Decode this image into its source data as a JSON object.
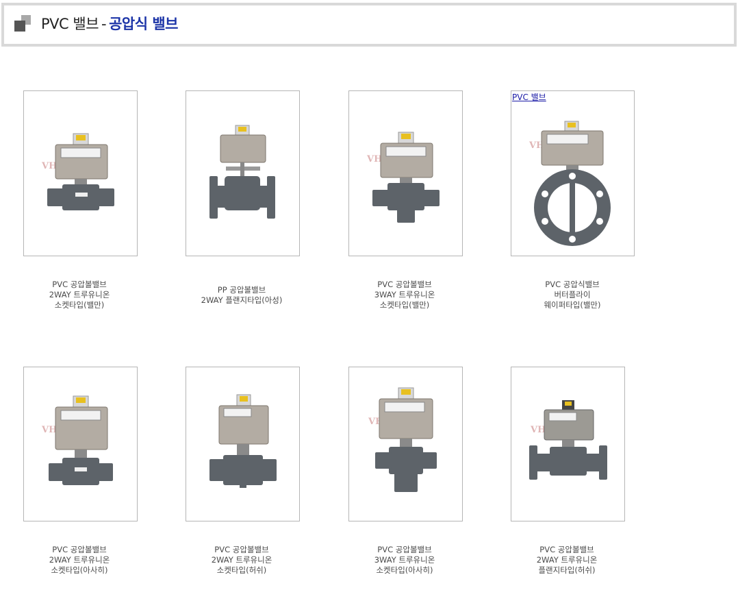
{
  "header": {
    "category": "PVC 밸브",
    "separator": "-",
    "subcategory": "공압식 밸브"
  },
  "watermark": "VHman.com",
  "colors": {
    "accent": "#1d35a8",
    "border": "#d9d9d9",
    "valve_body": "#5d6369",
    "actuator": "#b3aca3"
  },
  "products": [
    {
      "image_icon": "pvc-ball-valve-2way-socket-icon",
      "caption": [
        "PVC 공압볼밸브",
        "2WAY 트루유니온",
        "소켓타입(밸만)"
      ]
    },
    {
      "image_icon": "pp-ball-valve-2way-flange-icon",
      "caption": [
        "PP 공압볼밸브",
        "2WAY 플랜지타입(아성)"
      ]
    },
    {
      "image_icon": "pvc-ball-valve-3way-socket-icon",
      "caption": [
        "PVC 공압볼밸브",
        "3WAY 트루유니온",
        "소켓타입(밸만)"
      ]
    },
    {
      "image_icon": "pvc-butterfly-valve-wafer-icon",
      "link_text": "PVC 밸브",
      "caption": [
        "PVC 공압식밸브",
        "버터플라이",
        "웨이퍼타입(밸만)"
      ]
    },
    {
      "image_icon": "pvc-ball-valve-2way-socket-icon",
      "caption": [
        "PVC 공압볼밸브",
        "2WAY 트루유니온",
        "소켓타입(아사히)"
      ]
    },
    {
      "image_icon": "pvc-ball-valve-2way-socket-icon",
      "caption": [
        "PVC 공압볼밸브",
        "2WAY 트루유니온",
        "소켓타입(허쉬)"
      ]
    },
    {
      "image_icon": "pvc-ball-valve-3way-socket-icon",
      "caption": [
        "PVC 공압볼밸브",
        "3WAY 트루유니온",
        "소켓타입(아사히)"
      ]
    },
    {
      "image_icon": "pvc-ball-valve-2way-flange-icon",
      "caption": [
        "PVC 공압볼밸브",
        "2WAY 트루유니온",
        "플랜지타입(허쉬)"
      ]
    }
  ]
}
